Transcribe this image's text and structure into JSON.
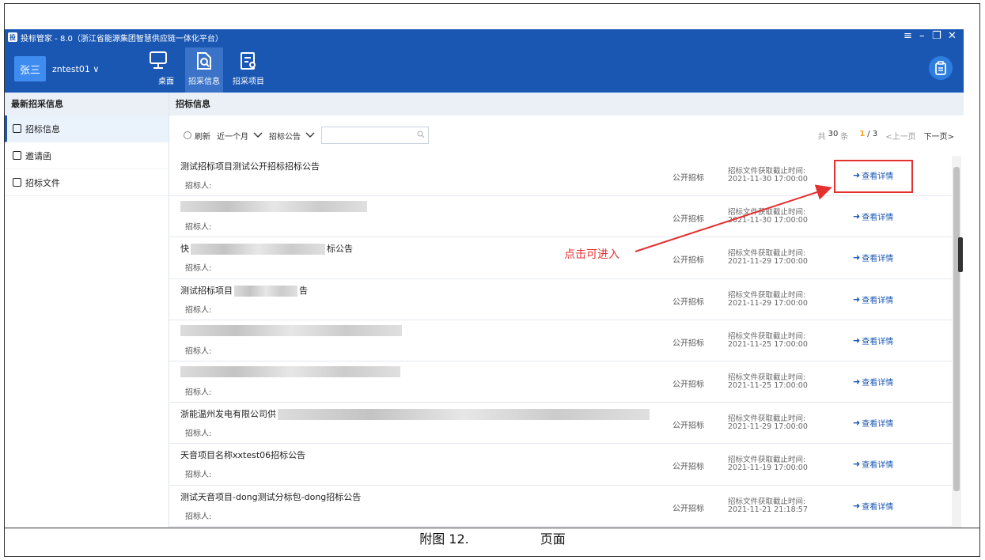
{
  "window": {
    "title": "投标管家 - 8.0（浙江省能源集团智慧供应链一体化平台）",
    "app_icon_letter": "投"
  },
  "user": {
    "avatar_text": "张三",
    "name": "zntest01 ∨"
  },
  "nav": [
    {
      "label": "桌面"
    },
    {
      "label": "招采信息"
    },
    {
      "label": "招采项目"
    }
  ],
  "sidebar": {
    "heading": "最新招采信息",
    "items": [
      {
        "label": "招标信息"
      },
      {
        "label": "邀请函"
      },
      {
        "label": "招标文件"
      }
    ]
  },
  "main": {
    "heading": "招标信息",
    "toolbar": {
      "refresh": "刷新",
      "period": "近一个月",
      "type": "招标公告",
      "search_placeholder": ""
    },
    "pager": {
      "total_prefix": "共",
      "total": "30",
      "total_suffix": "条",
      "current": "1",
      "pages": "/ 3",
      "prev": "<上一页",
      "next": "下一页>"
    },
    "rows": [
      {
        "title": "测试招标项目测试公开招标招标公告",
        "tenderer": "招标人:",
        "method": "公开招标",
        "deadline_label": "招标文件获取截止时间:",
        "deadline": "2021-11-30 17:00:00",
        "action": "查看详情"
      },
      {
        "title": "",
        "tenderer": "招标人:",
        "method": "公开招标",
        "deadline_label": "招标文件获取截止时间:",
        "deadline": "2021-11-30 17:00:00",
        "action": "查看详情"
      },
      {
        "title": "快",
        "title_tail": "标公告",
        "tenderer": "招标人:",
        "method": "公开招标",
        "deadline_label": "招标文件获取截止时间:",
        "deadline": "2021-11-29 17:00:00",
        "action": "查看详情"
      },
      {
        "title": "测试招标项目",
        "title_tail": "告",
        "tenderer": "招标人:",
        "method": "公开招标",
        "deadline_label": "招标文件获取截止时间:",
        "deadline": "2021-11-29 17:00:00",
        "action": "查看详情"
      },
      {
        "title": "",
        "tenderer": "招标人:",
        "method": "公开招标",
        "deadline_label": "招标文件获取截止时间:",
        "deadline": "2021-11-25 17:00:00",
        "action": "查看详情"
      },
      {
        "title": "",
        "tenderer": "招标人:",
        "method": "公开招标",
        "deadline_label": "招标文件获取截止时间:",
        "deadline": "2021-11-25 17:00:00",
        "action": "查看详情"
      },
      {
        "title": "浙能温州发电有限公司供",
        "tenderer": "招标人:",
        "method": "公开招标",
        "deadline_label": "招标文件获取截止时间:",
        "deadline": "2021-11-29 17:00:00",
        "action": "查看详情"
      },
      {
        "title": "天音项目名称xxtest06招标公告",
        "tenderer": "招标人:",
        "method": "公开招标",
        "deadline_label": "招标文件获取截止时间:",
        "deadline": "2021-11-19 17:00:00",
        "action": "查看详情"
      },
      {
        "title": "测试天音项目-dong测试分标包-dong招标公告",
        "tenderer": "招标人:",
        "method": "公开招标",
        "deadline_label": "招标文件获取截止时间:",
        "deadline": "2021-11-21 21:18:57",
        "action": "查看详情"
      }
    ]
  },
  "annotation": {
    "text": "点击可进入",
    "color": "#e53030"
  },
  "caption": {
    "left": "附图 12.",
    "right": "页面"
  },
  "colors": {
    "brand": "#1a57b3",
    "accent": "#3f8cf0",
    "highlight": "#e53030"
  }
}
